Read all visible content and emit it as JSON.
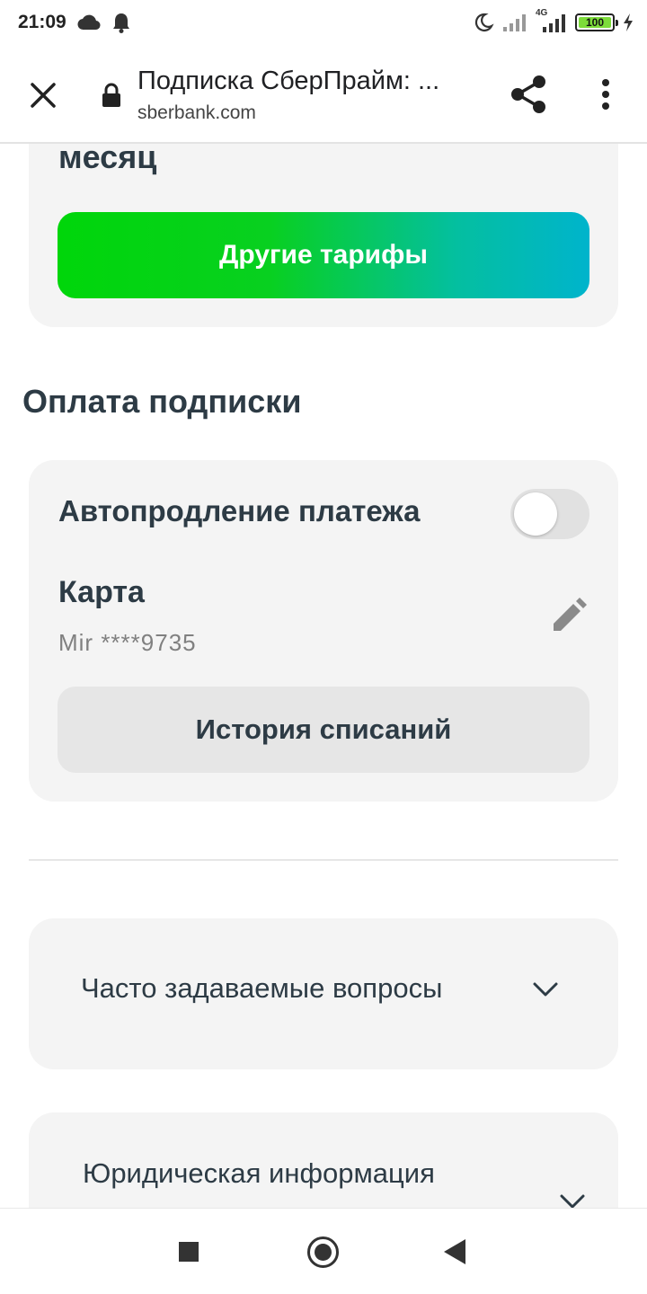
{
  "status_bar": {
    "time": "21:09",
    "network": "4G",
    "battery": "100",
    "battery_level_percent": 100,
    "icons": [
      "cloud-icon",
      "bell-icon",
      "moon-icon",
      "signal-icon",
      "signal-4g-icon",
      "battery-icon",
      "charging-icon"
    ]
  },
  "browser": {
    "page_title": "Подписка СберПрайм: ...",
    "url": "sberbank.com",
    "icons": [
      "close-icon",
      "lock-icon",
      "share-icon",
      "more-vert-icon"
    ]
  },
  "tariff_card": {
    "period_text": "месяц",
    "other_tariffs_button": "Другие тарифы"
  },
  "payment": {
    "section_title": "Оплата подписки",
    "autorenew_label": "Автопродление платежа",
    "autorenew_enabled": false,
    "card_label": "Карта",
    "card_number": "Mir ****9735",
    "history_button": "История списаний"
  },
  "faq": {
    "label": "Часто задаваемые вопросы"
  },
  "legal": {
    "label": "Юридическая информация"
  },
  "nav_bar": {
    "icons": [
      "recents-icon",
      "home-icon",
      "back-icon"
    ]
  },
  "colors": {
    "accent_gradient_start": "#00d60a",
    "accent_gradient_end": "#00b4cc",
    "card_background": "#f4f4f4",
    "text_primary": "#2d3b45"
  }
}
